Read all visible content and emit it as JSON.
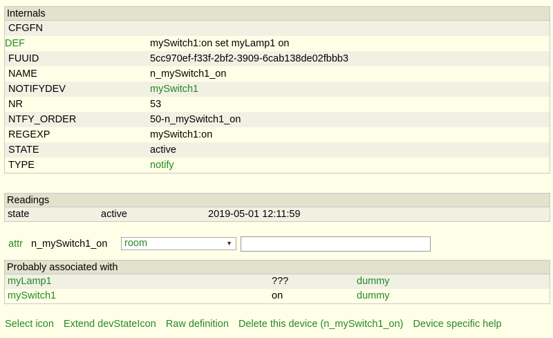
{
  "internals": {
    "title": "Internals",
    "rows": [
      {
        "key": "CFGFN",
        "value": ""
      },
      {
        "key": "DEF",
        "value": "mySwitch1:on set myLamp1 on"
      },
      {
        "key": "FUUID",
        "value": "5cc970ef-f33f-2bf2-3909-6cab138de02fbbb3"
      },
      {
        "key": "NAME",
        "value": "n_mySwitch1_on"
      },
      {
        "key": "NOTIFYDEV",
        "value": "mySwitch1"
      },
      {
        "key": "NR",
        "value": "53"
      },
      {
        "key": "NTFY_ORDER",
        "value": "50-n_mySwitch1_on"
      },
      {
        "key": "REGEXP",
        "value": "mySwitch1:on"
      },
      {
        "key": "STATE",
        "value": "active"
      },
      {
        "key": "TYPE",
        "value": "notify"
      }
    ]
  },
  "readings": {
    "title": "Readings",
    "rows": [
      {
        "name": "state",
        "value": "active",
        "time": "2019-05-01 12:11:59"
      }
    ]
  },
  "attr": {
    "label": "attr",
    "device": "n_mySwitch1_on",
    "selected": "room",
    "input_value": ""
  },
  "associated": {
    "title": "Probably associated with",
    "rows": [
      {
        "name": "myLamp1",
        "state": "???",
        "type": "dummy"
      },
      {
        "name": "mySwitch1",
        "state": "on",
        "type": "dummy"
      }
    ]
  },
  "footer": {
    "links": [
      "Select icon",
      "Extend devStateIcon",
      "Raw definition",
      "Delete this device (n_mySwitch1_on)",
      "Device specific help"
    ]
  },
  "colors": {
    "background": "#ffffe7",
    "header": "#e2e2cd",
    "odd_row": "#f1f1e3",
    "link": "#278727"
  }
}
